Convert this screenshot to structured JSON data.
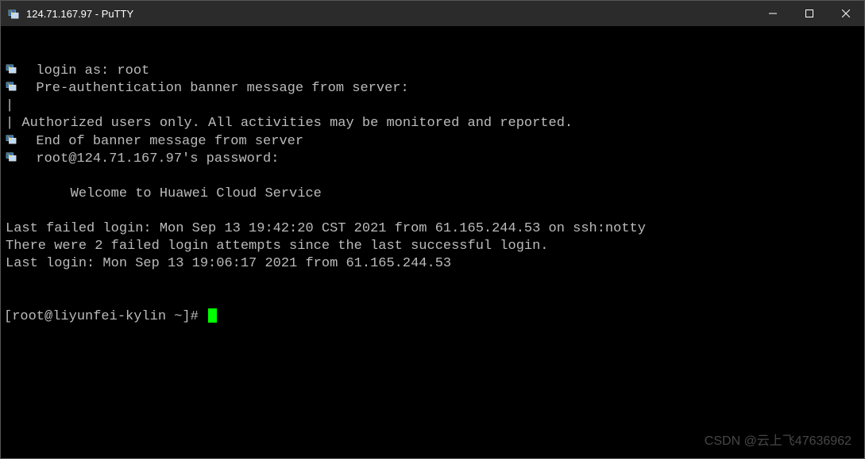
{
  "window": {
    "title": "124.71.167.97 - PuTTY"
  },
  "terminal": {
    "lines": [
      {
        "icon": true,
        "text": "  login as: root"
      },
      {
        "icon": true,
        "text": "  Pre-authentication banner message from server:"
      },
      {
        "icon": false,
        "text": "|"
      },
      {
        "icon": false,
        "text": "| Authorized users only. All activities may be monitored and reported."
      },
      {
        "icon": true,
        "text": "  End of banner message from server"
      },
      {
        "icon": true,
        "text": "  root@124.71.167.97's password:"
      },
      {
        "icon": false,
        "text": " "
      },
      {
        "icon": false,
        "text": "        Welcome to Huawei Cloud Service"
      },
      {
        "icon": false,
        "text": " "
      },
      {
        "icon": false,
        "text": "Last failed login: Mon Sep 13 19:42:20 CST 2021 from 61.165.244.53 on ssh:notty"
      },
      {
        "icon": false,
        "text": "There were 2 failed login attempts since the last successful login."
      },
      {
        "icon": false,
        "text": "Last login: Mon Sep 13 19:06:17 2021 from 61.165.244.53"
      }
    ],
    "prompt": "[root@liyunfei-kylin ~]# "
  },
  "watermark": "CSDN @云上飞47636962"
}
